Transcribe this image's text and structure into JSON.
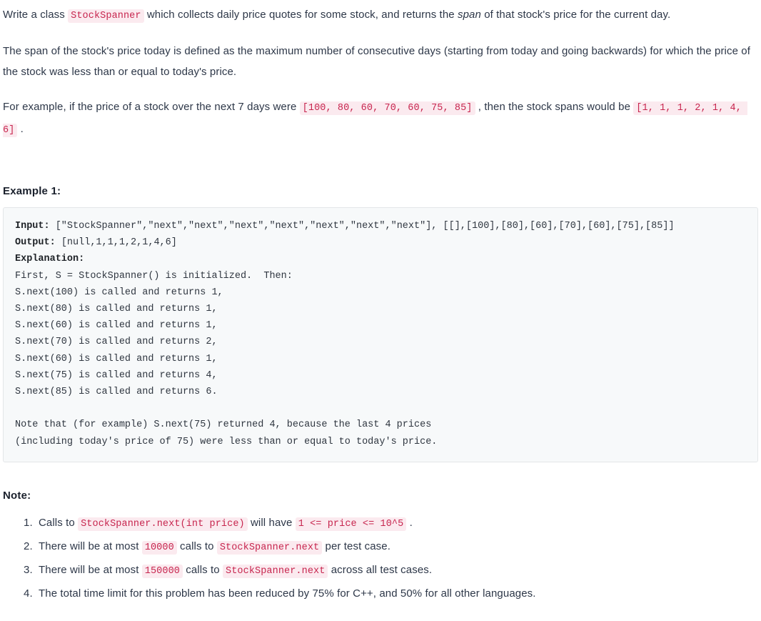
{
  "document": {
    "intro": {
      "p1_part1": "Write a class ",
      "p1_code": "StockSpanner",
      "p1_part2": " which collects daily price quotes for some stock, and returns the ",
      "p1_em": "span",
      "p1_part3": " of that stock's price for the current day.",
      "p2": "The span of the stock's price today is defined as the maximum number of consecutive days (starting from today and going backwards) for which the price of the stock was less than or equal to today's price.",
      "p3_part1": "For example, if the price of a stock over the next 7 days were ",
      "p3_code1": "[100, 80, 60, 70, 60, 75, 85]",
      "p3_part2": " , then the stock spans would be ",
      "p3_code2": "[1, 1, 1, 2, 1, 4, 6]",
      "p3_part3": " ."
    },
    "example": {
      "heading": "Example 1:",
      "input_label": "Input:",
      "input_value": " [\"StockSpanner\",\"next\",\"next\",\"next\",\"next\",\"next\",\"next\",\"next\"], [[],[100],[80],[60],[70],[60],[75],[85]]",
      "output_label": "Output:",
      "output_value": " [null,1,1,1,2,1,4,6]",
      "explanation_label": "Explanation:",
      "explanation_lines": [
        "First, S = StockSpanner() is initialized.  Then:",
        "S.next(100) is called and returns 1,",
        "S.next(80) is called and returns 1,",
        "S.next(60) is called and returns 1,",
        "S.next(70) is called and returns 2,",
        "S.next(60) is called and returns 1,",
        "S.next(75) is called and returns 4,",
        "S.next(85) is called and returns 6.",
        "",
        "Note that (for example) S.next(75) returned 4, because the last 4 prices",
        "(including today's price of 75) were less than or equal to today's price."
      ]
    },
    "note": {
      "heading": "Note:",
      "items": [
        {
          "t1": "Calls to ",
          "c1": "StockSpanner.next(int price)",
          "t2": " will have ",
          "c2": "1 <= price <= 10^5",
          "t3": " ."
        },
        {
          "t1": "There will be at most ",
          "c1": "10000",
          "t2": " calls to ",
          "c2": "StockSpanner.next",
          "t3": " per test case."
        },
        {
          "t1": "There will be at most ",
          "c1": "150000",
          "t2": " calls to ",
          "c2": "StockSpanner.next",
          "t3": " across all test cases."
        },
        {
          "t1": "The total time limit for this problem has been reduced by 75% for C++, and 50% for all other languages.",
          "c1": "",
          "t2": "",
          "c2": "",
          "t3": ""
        }
      ]
    },
    "colors": {
      "inline_code_text": "#c7254e",
      "inline_code_bg": "#fbeaef",
      "code_block_bg": "#f7f9fa",
      "code_block_border": "#e3e6e8",
      "body_text": "#2d3748"
    }
  }
}
